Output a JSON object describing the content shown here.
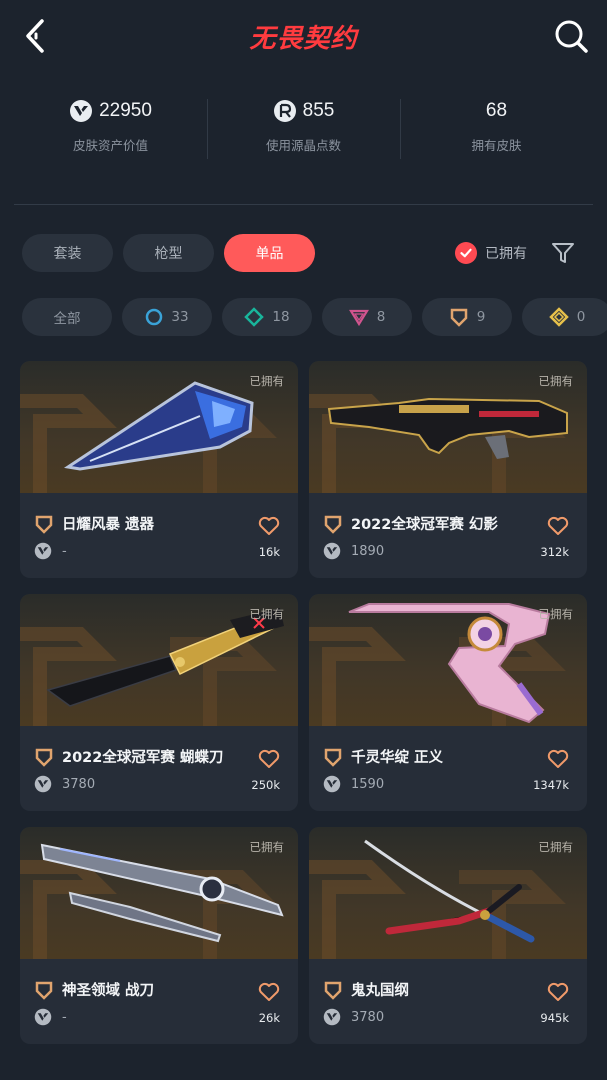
{
  "header": {
    "title": "无畏契约",
    "back_icon": "chevron-left-icon",
    "search_icon": "search-icon"
  },
  "stats": [
    {
      "value": "22950",
      "label": "皮肤资产价值",
      "icon": "vp-currency-icon"
    },
    {
      "value": "855",
      "label": "使用源晶点数",
      "icon": "radianite-icon"
    },
    {
      "value": "68",
      "label": "拥有皮肤",
      "icon": ""
    }
  ],
  "tabs": [
    {
      "label": "套装",
      "active": false
    },
    {
      "label": "枪型",
      "active": false
    },
    {
      "label": "单品",
      "active": true
    }
  ],
  "owned_filter": {
    "label": "已拥有",
    "checked": true
  },
  "tiers": [
    {
      "label": "全部",
      "count": ""
    },
    {
      "label": "",
      "count": "33",
      "icon": "select-tier-icon",
      "color": "#3aa3d8"
    },
    {
      "label": "",
      "count": "18",
      "icon": "deluxe-tier-icon",
      "color": "#19b59b"
    },
    {
      "label": "",
      "count": "8",
      "icon": "premium-tier-icon",
      "color": "#d1548e"
    },
    {
      "label": "",
      "count": "9",
      "icon": "ultra-tier-icon",
      "color": "#e0a46e"
    },
    {
      "label": "",
      "count": "0",
      "icon": "exclusive-tier-icon",
      "color": "#e6c04b"
    }
  ],
  "cards": [
    {
      "name": "日耀风暴 遗器",
      "price": "-",
      "likes": "16k",
      "owned": "已拥有"
    },
    {
      "name": "2022全球冠军赛 幻影",
      "price": "1890",
      "likes": "312k",
      "owned": "已拥有"
    },
    {
      "name": "2022全球冠军赛 蝴蝶刀",
      "price": "3780",
      "likes": "250k",
      "owned": "已拥有"
    },
    {
      "name": "千灵华绽 正义",
      "price": "1590",
      "likes": "1347k",
      "owned": "已拥有"
    },
    {
      "name": "神圣领域 战刀",
      "price": "-",
      "likes": "26k",
      "owned": "已拥有"
    },
    {
      "name": "鬼丸国纲",
      "price": "3780",
      "likes": "945k",
      "owned": "已拥有"
    }
  ],
  "colors": {
    "accent": "#ff5a5a",
    "title": "#ff3b3f",
    "tier_icon": "#e0a46e"
  }
}
